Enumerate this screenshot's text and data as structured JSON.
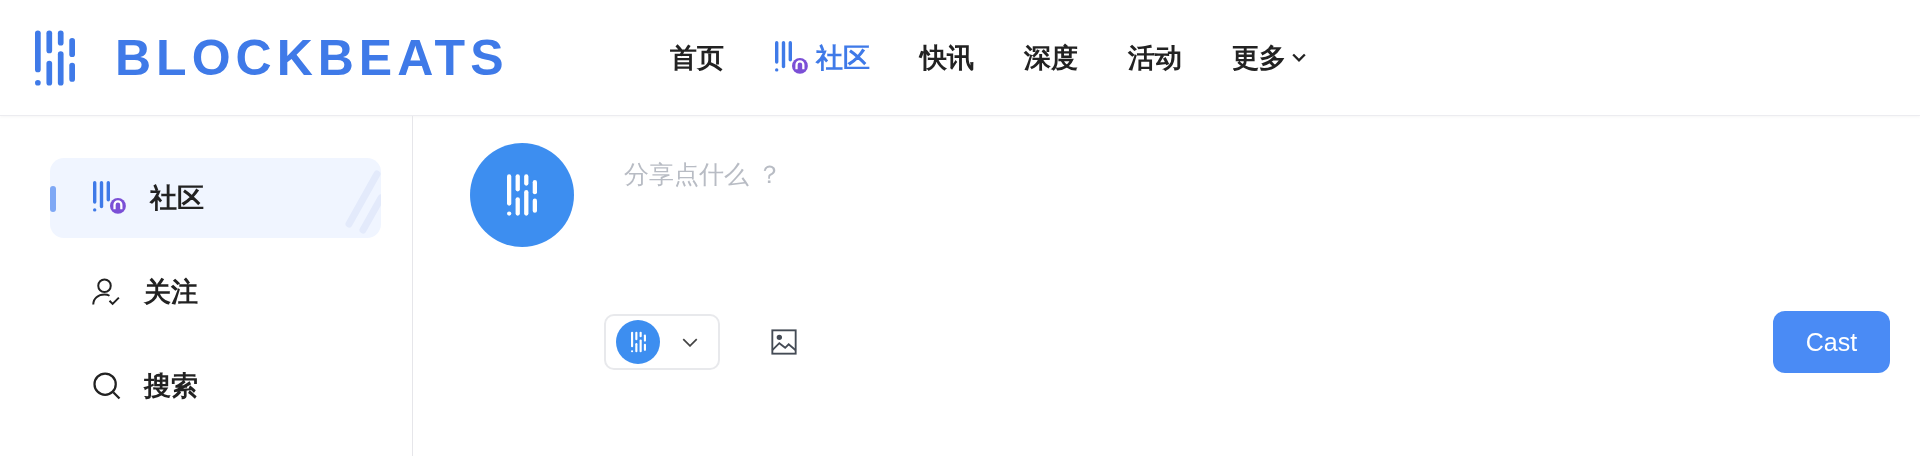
{
  "brand": {
    "name": "BLOCKBEATS"
  },
  "nav": [
    {
      "label": "首页",
      "selected": false,
      "kind": "plain"
    },
    {
      "label": "社区",
      "selected": true,
      "kind": "community"
    },
    {
      "label": "快讯",
      "selected": false,
      "kind": "plain"
    },
    {
      "label": "深度",
      "selected": false,
      "kind": "plain"
    },
    {
      "label": "活动",
      "selected": false,
      "kind": "plain"
    },
    {
      "label": "更多",
      "selected": false,
      "kind": "dropdown"
    }
  ],
  "sidebar": {
    "items": [
      {
        "label": "社区",
        "selected": true,
        "kind": "community"
      },
      {
        "label": "关注",
        "selected": false,
        "kind": "follow"
      },
      {
        "label": "搜索",
        "selected": false,
        "kind": "search"
      }
    ]
  },
  "composer": {
    "placeholder": "分享点什么 ？",
    "submit": "Cast"
  }
}
